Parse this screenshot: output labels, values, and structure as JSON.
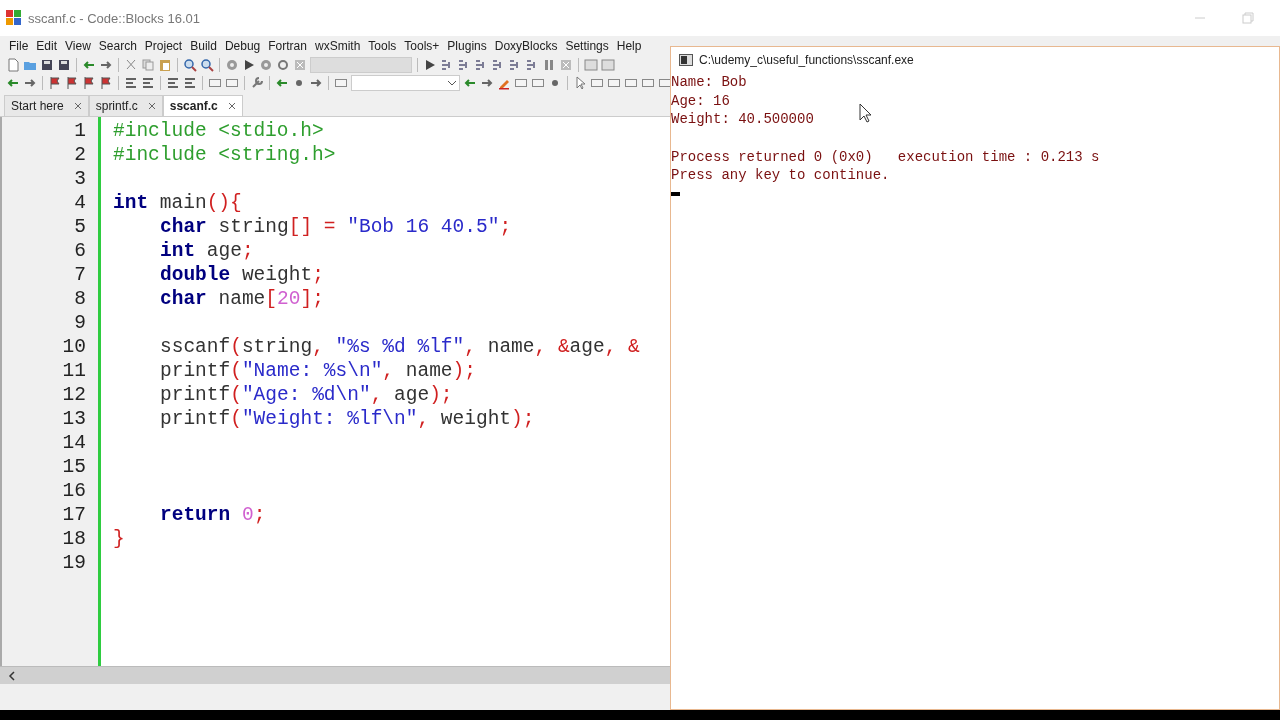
{
  "window": {
    "title": "sscanf.c - Code::Blocks 16.01"
  },
  "menu": [
    "File",
    "Edit",
    "View",
    "Search",
    "Project",
    "Build",
    "Debug",
    "Fortran",
    "wxSmith",
    "Tools",
    "Tools+",
    "Plugins",
    "DoxyBlocks",
    "Settings",
    "Help"
  ],
  "tabs": [
    {
      "label": "Start here",
      "selected": false
    },
    {
      "label": "sprintf.c",
      "selected": false
    },
    {
      "label": "sscanf.c",
      "selected": true
    }
  ],
  "editor": {
    "lines": [
      {
        "number": "1",
        "indented": false,
        "tokens": [
          {
            "kind": "pre",
            "text": "#include <stdio.h>"
          }
        ]
      },
      {
        "number": "2",
        "indented": false,
        "tokens": [
          {
            "kind": "pre",
            "text": "#include <string.h>"
          }
        ]
      },
      {
        "number": "3"
      },
      {
        "number": "4",
        "indented": false,
        "tokens": [
          {
            "kind": "kw",
            "text": "int"
          },
          {
            "kind": "id",
            "text": " main"
          },
          {
            "kind": "op",
            "text": "(){"
          }
        ]
      },
      {
        "number": "5",
        "indented": true,
        "tokens": [
          {
            "kind": "kw",
            "text": "char"
          },
          {
            "kind": "id",
            "text": " string"
          },
          {
            "kind": "op",
            "text": "[] = "
          },
          {
            "kind": "str",
            "text": "\"Bob 16 40.5\""
          },
          {
            "kind": "op",
            "text": ";"
          }
        ]
      },
      {
        "number": "6",
        "indented": true,
        "tokens": [
          {
            "kind": "kw",
            "text": "int"
          },
          {
            "kind": "id",
            "text": " age"
          },
          {
            "kind": "op",
            "text": ";"
          }
        ]
      },
      {
        "number": "7",
        "indented": true,
        "tokens": [
          {
            "kind": "kw",
            "text": "double"
          },
          {
            "kind": "id",
            "text": " weight"
          },
          {
            "kind": "op",
            "text": ";"
          }
        ]
      },
      {
        "number": "8",
        "indented": true,
        "tokens": [
          {
            "kind": "kw",
            "text": "char"
          },
          {
            "kind": "id",
            "text": " name"
          },
          {
            "kind": "op",
            "text": "["
          },
          {
            "kind": "num",
            "text": "20"
          },
          {
            "kind": "op",
            "text": "];"
          }
        ]
      },
      {
        "number": "9"
      },
      {
        "number": "10",
        "indented": true,
        "tokens": [
          {
            "kind": "id",
            "text": "sscanf"
          },
          {
            "kind": "op",
            "text": "("
          },
          {
            "kind": "id",
            "text": "string"
          },
          {
            "kind": "op",
            "text": ", "
          },
          {
            "kind": "str",
            "text": "\"%s %d %lf\""
          },
          {
            "kind": "op",
            "text": ", "
          },
          {
            "kind": "id",
            "text": "name"
          },
          {
            "kind": "op",
            "text": ", &"
          },
          {
            "kind": "id",
            "text": "age"
          },
          {
            "kind": "op",
            "text": ", &"
          }
        ]
      },
      {
        "number": "11",
        "indented": true,
        "tokens": [
          {
            "kind": "id",
            "text": "printf"
          },
          {
            "kind": "op",
            "text": "("
          },
          {
            "kind": "str",
            "text": "\"Name: %s\\n\""
          },
          {
            "kind": "op",
            "text": ", "
          },
          {
            "kind": "id",
            "text": "name"
          },
          {
            "kind": "op",
            "text": ");"
          }
        ]
      },
      {
        "number": "12",
        "indented": true,
        "tokens": [
          {
            "kind": "id",
            "text": "printf"
          },
          {
            "kind": "op",
            "text": "("
          },
          {
            "kind": "str",
            "text": "\"Age: %d\\n\""
          },
          {
            "kind": "op",
            "text": ", "
          },
          {
            "kind": "id",
            "text": "age"
          },
          {
            "kind": "op",
            "text": ");"
          }
        ]
      },
      {
        "number": "13",
        "indented": true,
        "tokens": [
          {
            "kind": "id",
            "text": "printf"
          },
          {
            "kind": "op",
            "text": "("
          },
          {
            "kind": "str",
            "text": "\"Weight: %lf\\n\""
          },
          {
            "kind": "op",
            "text": ", "
          },
          {
            "kind": "id",
            "text": "weight"
          },
          {
            "kind": "op",
            "text": ");"
          }
        ]
      },
      {
        "number": "14"
      },
      {
        "number": "15"
      },
      {
        "number": "16"
      },
      {
        "number": "17",
        "indented": true,
        "tokens": [
          {
            "kind": "kw",
            "text": "return"
          },
          {
            "kind": "num",
            "text": " 0"
          },
          {
            "kind": "op",
            "text": ";"
          }
        ]
      },
      {
        "number": "18",
        "indented": false,
        "tokens": [
          {
            "kind": "op",
            "text": "}"
          }
        ]
      },
      {
        "number": "19"
      }
    ]
  },
  "console": {
    "title": "C:\\udemy_c\\useful_functions\\sscanf.exe",
    "output": [
      "Name: Bob",
      "Age: 16",
      "Weight: 40.500000"
    ],
    "summary": [
      "Process returned 0 (0x0)   execution time : 0.213 s",
      "Press any key to continue."
    ]
  }
}
